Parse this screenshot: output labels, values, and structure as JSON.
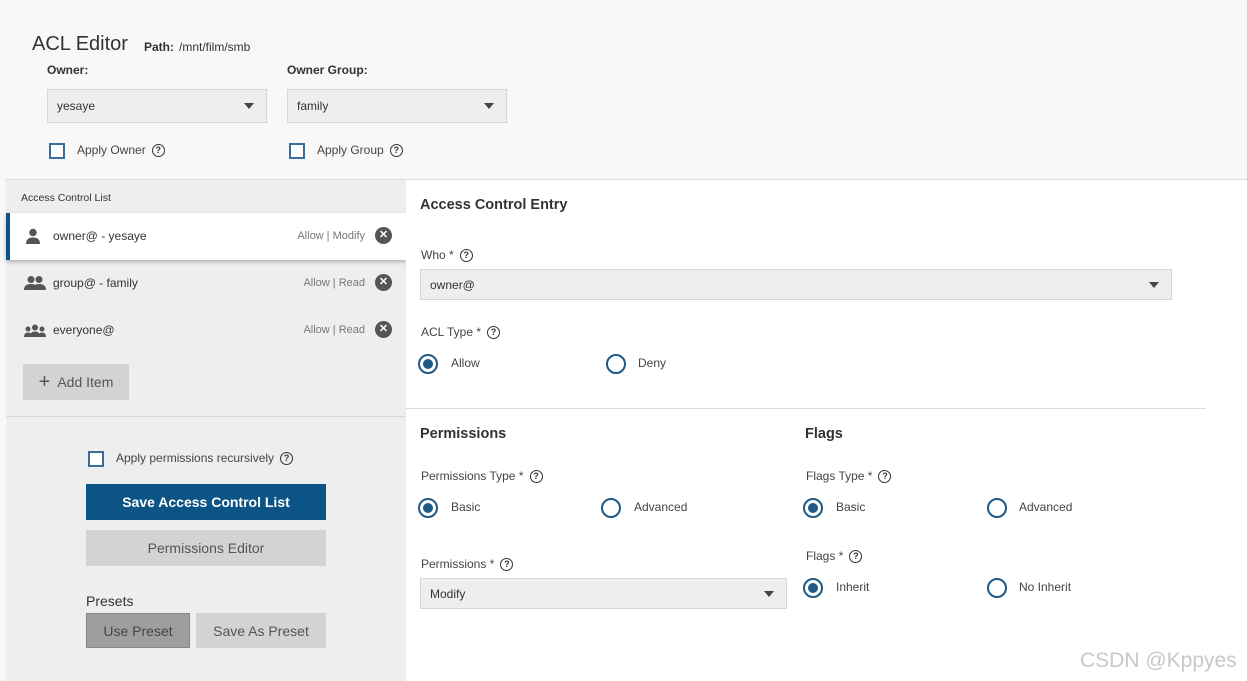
{
  "header": {
    "title": "ACL Editor",
    "path_label": "Path:",
    "path_value": "/mnt/film/smb",
    "owner_label": "Owner:",
    "owner_value": "yesaye",
    "owner_group_label": "Owner Group:",
    "owner_group_value": "family",
    "apply_owner_label": "Apply Owner",
    "apply_group_label": "Apply Group"
  },
  "acl_list": {
    "title": "Access Control List",
    "items": [
      {
        "name": "owner@ - yesaye",
        "perm": "Allow | Modify",
        "icon": "person-icon"
      },
      {
        "name": "group@ - family",
        "perm": "Allow | Read",
        "icon": "group-icon"
      },
      {
        "name": "everyone@",
        "perm": "Allow | Read",
        "icon": "everyone-icon"
      }
    ],
    "add_item_label": "Add Item"
  },
  "actions": {
    "recursive_label": "Apply permissions recursively",
    "save_label": "Save Access Control List",
    "perm_editor_label": "Permissions Editor",
    "presets_label": "Presets",
    "use_preset_label": "Use Preset",
    "save_as_preset_label": "Save As Preset"
  },
  "entry": {
    "title": "Access Control Entry",
    "who_label": "Who *",
    "who_value": "owner@",
    "acl_type_label": "ACL Type *",
    "allow_label": "Allow",
    "deny_label": "Deny",
    "permissions_title": "Permissions",
    "permissions_type_label": "Permissions Type *",
    "perm_basic_label": "Basic",
    "perm_advanced_label": "Advanced",
    "permissions_label": "Permissions *",
    "permissions_value": "Modify",
    "flags_title": "Flags",
    "flags_type_label": "Flags Type *",
    "flags_basic_label": "Basic",
    "flags_advanced_label": "Advanced",
    "flags_label": "Flags *",
    "inherit_label": "Inherit",
    "no_inherit_label": "No Inherit"
  },
  "watermark": "CSDN @Kppyes",
  "colors": {
    "accent": "#0d5486",
    "radio": "#1d5a86"
  }
}
